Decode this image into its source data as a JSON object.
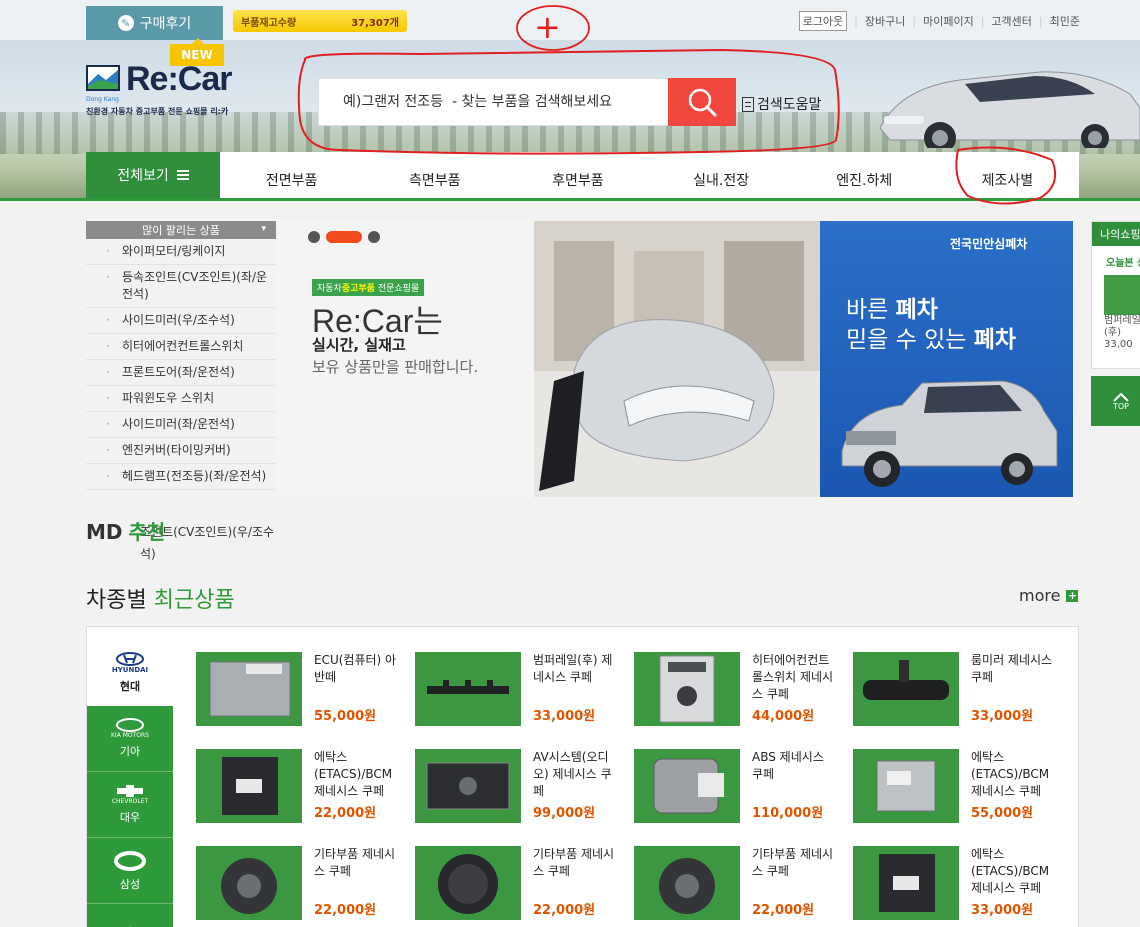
{
  "topbar": {
    "review_label": "구매후기",
    "stock_label": "부품재고수량",
    "stock_count": "37,307개",
    "new_tag": "NEW",
    "nav": [
      "로그아웃",
      "장바구니",
      "마이페이지",
      "고객센터",
      "최민준"
    ]
  },
  "logo": {
    "brand": "Re:Car",
    "mark_text": "Dong Kang",
    "tagline": "친환경 자동차 중고부품 전문 쇼핑몰 리:카"
  },
  "search": {
    "placeholder": "예)그랜저 전조등  - 찾는 부품을 검색해보세요",
    "help_label": "검색도움말"
  },
  "nav": {
    "all_label": "전체보기",
    "items": [
      "전면부품",
      "측면부품",
      "후면부품",
      "실내.전장",
      "엔진.하체",
      "제조사별"
    ]
  },
  "bestsellers": {
    "title": "많이 팔리는 상품",
    "items": [
      "와이퍼모터/링케이지",
      "등속조인트(CV조인트)(좌/운전석)",
      "사이드미러(우/조수석)",
      "히터에어컨컨트롤스위치",
      "프론트도어(좌/운전석)",
      "파워윈도우 스위치",
      "사이드미러(좌/운전석)",
      "엔진커버(타이밍커버)",
      "헤드램프(전조등)(좌/운전석)"
    ],
    "overflow_text": "조인트(CV조인트)(우/조수석)"
  },
  "slider": {
    "tag_pre": "자동차",
    "tag_bold": "중고부품",
    "tag_post": " 전문쇼핑몰",
    "headline": "Re:Car는",
    "line1": "실시간, 실재고",
    "line2": "보유 상품만을 판매합니다."
  },
  "promo": {
    "badge": "전국민안심폐차",
    "line1_a": "바른 ",
    "line1_b": "폐차",
    "line2_a": "믿을 수 있는 ",
    "line2_b": "폐차"
  },
  "quick": {
    "title": "나의쇼핑",
    "subtitle": "오늘본 상품",
    "item_name": "범퍼레일",
    "item_sub": "(후)",
    "item_price": "33,00",
    "top_label": "TOP"
  },
  "md": {
    "prefix": "MD",
    "suffix": "추천"
  },
  "recent": {
    "title_a": "차종별 ",
    "title_b": "최근상품",
    "more_label": "more"
  },
  "brands": [
    {
      "logo": "HYUNDAI",
      "label": "현대"
    },
    {
      "logo": "KIA MOTORS",
      "label": "기아"
    },
    {
      "logo": "CHEVROLET",
      "label": "대우"
    },
    {
      "logo": "",
      "label": "삼성"
    },
    {
      "logo": "",
      "label": ""
    }
  ],
  "products": [
    {
      "name": "ECU(컴퓨터) 아반떼",
      "price": "55,000원"
    },
    {
      "name": "범퍼레일(후) 제네시스 쿠페",
      "price": "33,000원"
    },
    {
      "name": "히터에어컨컨트롤스위치 제네시스 쿠페",
      "price": "44,000원"
    },
    {
      "name": "룸미러 제네시스 쿠페",
      "price": "33,000원"
    },
    {
      "name": "에탁스(ETACS)/BCM 제네시스 쿠페",
      "price": "22,000원"
    },
    {
      "name": "AV시스템(오디오) 제네시스 쿠페",
      "price": "99,000원"
    },
    {
      "name": "ABS 제네시스 쿠페",
      "price": "110,000원"
    },
    {
      "name": "에탁스(ETACS)/BCM 제네시스 쿠페",
      "price": "55,000원"
    },
    {
      "name": "기타부품 제네시스 쿠페",
      "price": "22,000원"
    },
    {
      "name": "기타부품 제네시스 쿠페",
      "price": "22,000원"
    },
    {
      "name": "기타부품 제네시스 쿠페",
      "price": "22,000원"
    },
    {
      "name": "에탁스(ETACS)/BCM 제네시스 쿠페",
      "price": "33,000원"
    }
  ],
  "colors": {
    "green": "#2f9a3a",
    "search_button": "#f2473f",
    "price": "#e05400",
    "annotation": "#e02020"
  },
  "annotations": {
    "mark": "+"
  }
}
